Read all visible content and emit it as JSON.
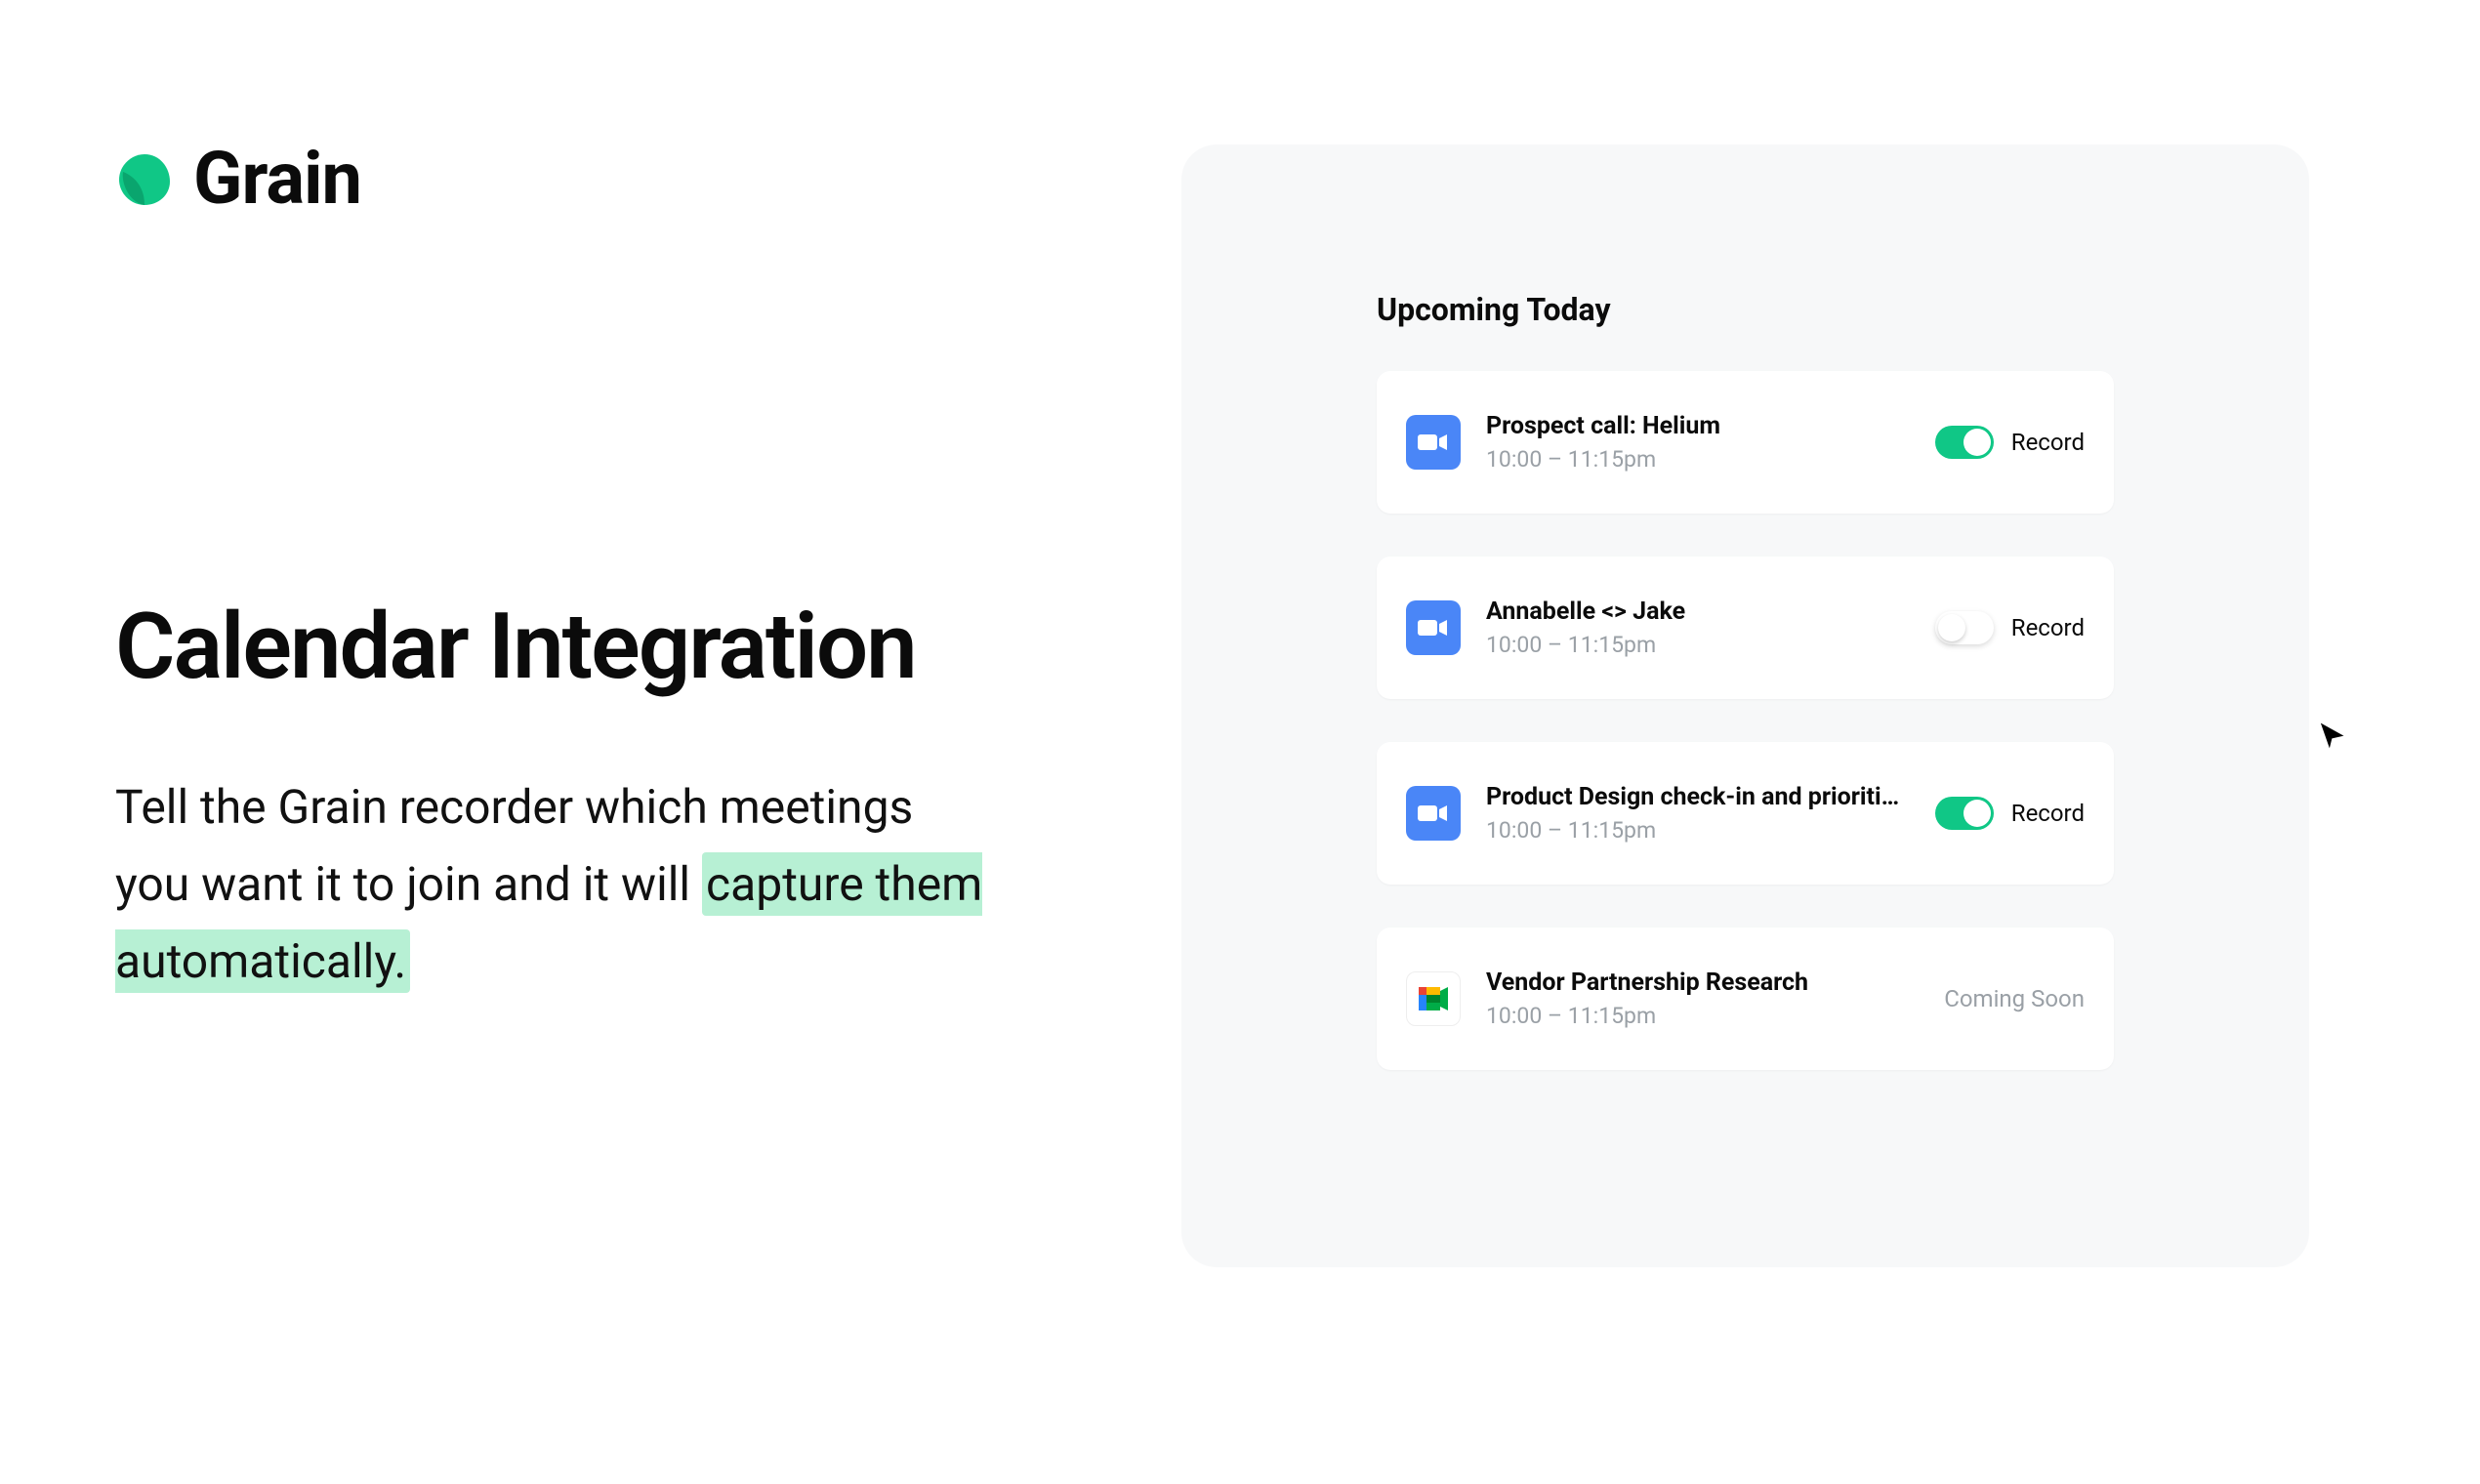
{
  "brand": {
    "name": "Grain"
  },
  "hero": {
    "title": "Calendar Integration",
    "subcopy_before": "Tell the Grain recorder which meetings you want it to join and it will ",
    "subcopy_highlight": "capture them automatically."
  },
  "panel": {
    "heading": "Upcoming Today",
    "record_label": "Record",
    "coming_soon_label": "Coming Soon",
    "meetings": [
      {
        "title": "Prospect call: Helium",
        "time": "10:00 – 11:15pm",
        "provider": "zoom",
        "recording": true
      },
      {
        "title": "Annabelle <> Jake",
        "time": "10:00 – 11:15pm",
        "provider": "zoom",
        "recording": false
      },
      {
        "title": "Product Design check-in and prioritiza...",
        "time": "10:00 – 11:15pm",
        "provider": "zoom",
        "recording": true
      },
      {
        "title": "Vendor Partnership Research",
        "time": "10:00 – 11:15pm",
        "provider": "gmeet",
        "coming_soon": true
      }
    ]
  }
}
